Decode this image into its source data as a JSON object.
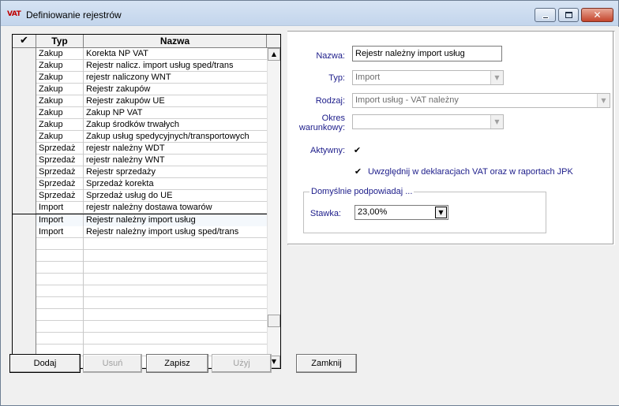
{
  "window": {
    "title": "Definiowanie rejestrów",
    "app_icon": "VAT",
    "controls": {
      "minimize": "minimize-icon",
      "maximize": "maximize-icon",
      "close": "close-icon"
    }
  },
  "grid": {
    "headers": {
      "check": "✔",
      "typ": "Typ",
      "nazwa": "Nazwa"
    },
    "rows": [
      {
        "typ": "Zakup",
        "nazwa": "Korekta NP VAT"
      },
      {
        "typ": "Zakup",
        "nazwa": "Rejestr nalicz. import usług sped/trans"
      },
      {
        "typ": "Zakup",
        "nazwa": "rejestr naliczony WNT"
      },
      {
        "typ": "Zakup",
        "nazwa": "Rejestr zakupów"
      },
      {
        "typ": "Zakup",
        "nazwa": "Rejestr zakupów UE"
      },
      {
        "typ": "Zakup",
        "nazwa": "Zakup NP VAT"
      },
      {
        "typ": "Zakup",
        "nazwa": "Zakup środków trwałych"
      },
      {
        "typ": "Zakup",
        "nazwa": "Zakup usług spedycyjnych/transportowych"
      },
      {
        "typ": "Sprzedaż",
        "nazwa": "rejestr należny WDT"
      },
      {
        "typ": "Sprzedaż",
        "nazwa": "rejestr należny WNT"
      },
      {
        "typ": "Sprzedaż",
        "nazwa": "Rejestr sprzedaży"
      },
      {
        "typ": "Sprzedaż",
        "nazwa": "Sprzedaż korekta"
      },
      {
        "typ": "Sprzedaż",
        "nazwa": "Sprzedaż usług do UE"
      },
      {
        "typ": "Import",
        "nazwa": "rejestr należny dostawa towarów"
      },
      {
        "typ": "Import",
        "nazwa": "Rejestr należny import usług"
      },
      {
        "typ": "Import",
        "nazwa": "Rejestr należny import usług sped/trans"
      }
    ],
    "selected_row": 14
  },
  "form": {
    "nazwa_label": "Nazwa:",
    "nazwa_value": "Rejestr należny import usług",
    "typ_label": "Typ:",
    "typ_value": "Import",
    "rodzaj_label": "Rodzaj:",
    "rodzaj_value": "Import usług - VAT należny",
    "okres_label_1": "Okres",
    "okres_label_2": "warunkowy:",
    "okres_value": "",
    "aktywny_label": "Aktywny:",
    "aktywny_checked": "✔",
    "uwzglednij_label": "Uwzględnij w deklaracjach VAT oraz w raportach JPK",
    "uwzglednij_checked": "✔",
    "group_title": "Domyślnie podpowiadaj ...",
    "stawka_label": "Stawka:",
    "stawka_value": "23,00%"
  },
  "buttons": {
    "dodaj": "Dodaj",
    "usun": "Usuń",
    "zapisz": "Zapisz",
    "uzyj": "Użyj",
    "zamknij": "Zamknij"
  },
  "colors": {
    "label_blue": "#1c1c8a",
    "disabled_text": "#a0a0a0",
    "icon_red": "#c00000"
  }
}
